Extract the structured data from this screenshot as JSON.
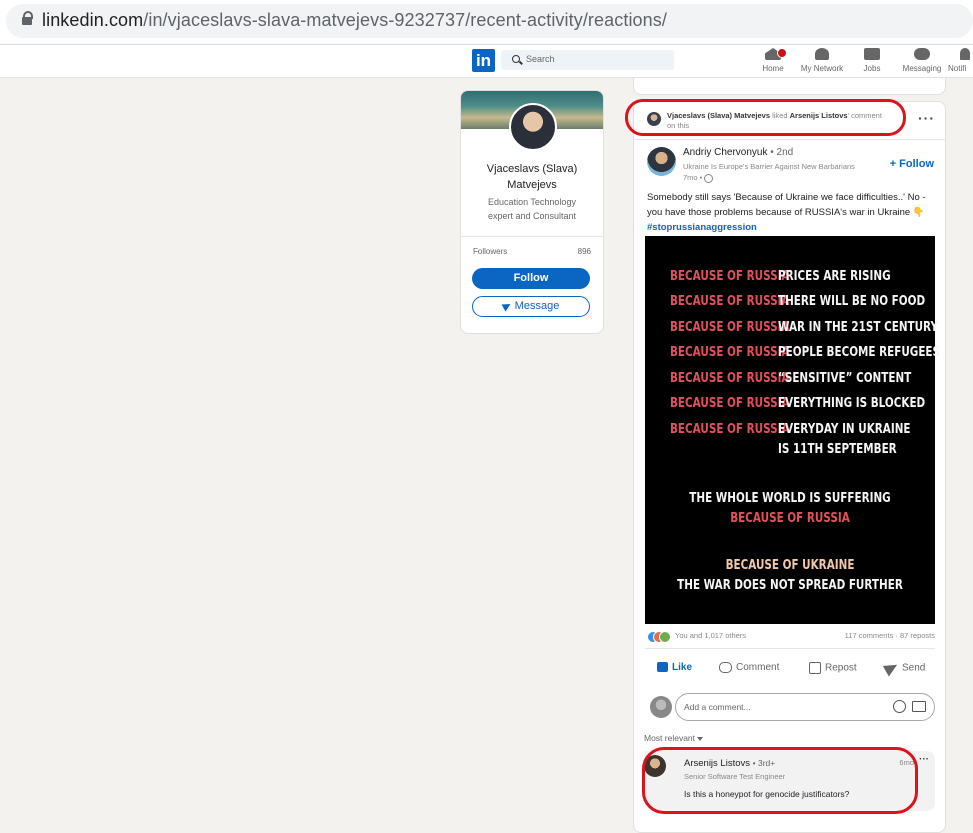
{
  "browser": {
    "url_host": "linkedin.com",
    "url_path": "/in/vjaceslavs-slava-matvejevs-9232737/recent-activity/reactions/"
  },
  "nav": {
    "logo": "in",
    "search_placeholder": "Search",
    "items": [
      {
        "label": "Home",
        "icon": "home-icon"
      },
      {
        "label": "My Network",
        "icon": "network-icon"
      },
      {
        "label": "Jobs",
        "icon": "briefcase-icon"
      },
      {
        "label": "Messaging",
        "icon": "messaging-icon"
      },
      {
        "label": "Notifi",
        "icon": "bell-icon"
      }
    ]
  },
  "profile": {
    "name_line1": "Vjaceslavs (Slava)",
    "name_line2": "Matvejevs",
    "description_line1": "Education Technology",
    "description_line2": "expert and Consultant",
    "followers_label": "Followers",
    "followers_count": "896",
    "follow_label": "Follow",
    "message_label": "Message"
  },
  "post": {
    "header": {
      "actor": "Vjaceslavs (Slava) Matvejevs",
      "verb": "liked",
      "target": "Arsenijs Listovs",
      "suffix_line1": "' comment",
      "suffix_line2": "on this"
    },
    "more_label": "···",
    "author": {
      "name": "Andriy Chervonyuk",
      "degree": "• 2nd",
      "headline": "Ukraine Is Europe's Barrier Against New Barbarians",
      "time": "7mo •",
      "follow_label": "+ Follow"
    },
    "text_line1": "Somebody still says 'Because of Ukraine we face difficulties..' No -",
    "text_line2": "you have those problems because of RUSSIA's war in Ukraine 👇",
    "hashtag": "#stoprussianaggression",
    "image": {
      "rows": [
        {
          "left": "BECAUSE OF RUSSIA",
          "right": "PRICES ARE RISING"
        },
        {
          "left": "BECAUSE OF RUSSIA",
          "right": "THERE WILL BE NO FOOD"
        },
        {
          "left": "BECAUSE OF RUSSIA",
          "right": "WAR IN THE 21ST CENTURY"
        },
        {
          "left": "BECAUSE OF RUSSIA",
          "right": "PEOPLE BECOME REFUGEES"
        },
        {
          "left": "BECAUSE OF RUSSIA",
          "right": "“SENSITIVE” CONTENT"
        },
        {
          "left": "BECAUSE OF RUSSIA",
          "right": "EVERYTHING IS BLOCKED"
        },
        {
          "left": "BECAUSE OF RUSSIA",
          "right": "EVERYDAY IN UKRAINE"
        }
      ],
      "row7_cont": "IS 11TH SEPTEMBER",
      "world_line": "THE WHOLE WORLD IS SUFFERING",
      "world_red": "BECAUSE OF RUSSIA",
      "ukraine_line": "BECAUSE OF UKRAINE",
      "war_line": "THE WAR DOES NOT SPREAD FURTHER"
    },
    "reactions_text": "You and 1,017 others",
    "comments_reposts": "117 comments · 87 reposts",
    "actions": {
      "like": "Like",
      "comment": "Comment",
      "repost": "Repost",
      "send": "Send"
    },
    "comment_placeholder": "Add a comment...",
    "sort_label": "Most relevant",
    "comment": {
      "name": "Arsenijs Listovs",
      "degree": "• 3rd+",
      "title": "Senior Software Test Engineer",
      "time": "6mo",
      "text": "Is this a honeypot for genocide justificators?"
    }
  },
  "colors": {
    "linkedin_blue": "#0a66c2",
    "annotation_red": "#d9141c",
    "image_red": "#e2505b"
  }
}
